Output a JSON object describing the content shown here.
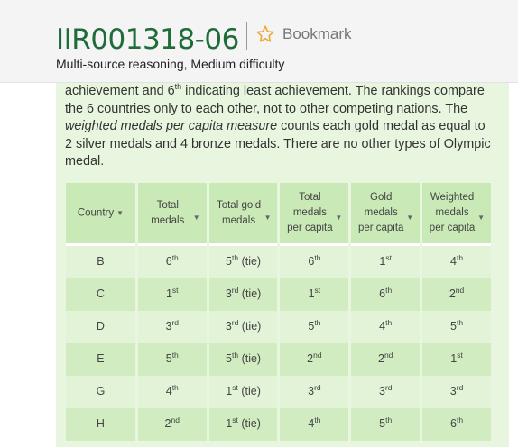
{
  "header": {
    "title": "IIR001318-06",
    "bookmark_label": "Bookmark",
    "subtitle": "Multi-source reasoning, Medium difficulty"
  },
  "passage": {
    "line1_a": "achievement and 6",
    "line1_sup": "th",
    "line1_b": " indicating least achievement. The rankings compare",
    "line2": "the 6 countries only to each other, not to other competing nations. The",
    "line3_em": "weighted medals per capita measure",
    "line3_b": " counts each gold medal as equal to",
    "line4": "2 silver medals and 4 bronze medals. There are no other types of Olympic",
    "line5": "medal."
  },
  "table": {
    "headers": [
      {
        "lines": [
          "Country"
        ]
      },
      {
        "lines": [
          "Total",
          "medals"
        ]
      },
      {
        "lines": [
          "Total gold",
          "medals"
        ]
      },
      {
        "lines": [
          "Total",
          "medals",
          "per capita"
        ]
      },
      {
        "lines": [
          "Gold",
          "medals",
          "per capita"
        ]
      },
      {
        "lines": [
          "Weighted",
          "medals",
          "per capita"
        ]
      }
    ],
    "sort_caret": "▼",
    "rows": [
      {
        "country": "B",
        "cells": [
          [
            "6",
            "th",
            ""
          ],
          [
            "5",
            "th",
            " (tie)"
          ],
          [
            "6",
            "th",
            ""
          ],
          [
            "1",
            "st",
            ""
          ],
          [
            "4",
            "th",
            ""
          ]
        ]
      },
      {
        "country": "C",
        "cells": [
          [
            "1",
            "st",
            ""
          ],
          [
            "3",
            "rd",
            " (tie)"
          ],
          [
            "1",
            "st",
            ""
          ],
          [
            "6",
            "th",
            ""
          ],
          [
            "2",
            "nd",
            ""
          ]
        ]
      },
      {
        "country": "D",
        "cells": [
          [
            "3",
            "rd",
            ""
          ],
          [
            "3",
            "rd",
            " (tie)"
          ],
          [
            "5",
            "th",
            ""
          ],
          [
            "4",
            "th",
            ""
          ],
          [
            "5",
            "th",
            ""
          ]
        ]
      },
      {
        "country": "E",
        "cells": [
          [
            "5",
            "th",
            ""
          ],
          [
            "5",
            "th",
            " (tie)"
          ],
          [
            "2",
            "nd",
            ""
          ],
          [
            "2",
            "nd",
            ""
          ],
          [
            "1",
            "st",
            ""
          ]
        ]
      },
      {
        "country": "G",
        "cells": [
          [
            "4",
            "th",
            ""
          ],
          [
            "1",
            "st",
            " (tie)"
          ],
          [
            "3",
            "rd",
            ""
          ],
          [
            "3",
            "rd",
            ""
          ],
          [
            "3",
            "rd",
            ""
          ]
        ]
      },
      {
        "country": "H",
        "cells": [
          [
            "2",
            "nd",
            ""
          ],
          [
            "1",
            "st",
            " (tie)"
          ],
          [
            "4",
            "th",
            ""
          ],
          [
            "5",
            "th",
            ""
          ],
          [
            "6",
            "th",
            ""
          ]
        ]
      }
    ]
  },
  "colors": {
    "title": "#1f6b3a",
    "panel_bg": "#e8f5df",
    "header_cell": "#c9e9b6",
    "row_light": "#e2f3d8",
    "row_dark": "#d0ecc0",
    "star": "#f2a93b"
  }
}
